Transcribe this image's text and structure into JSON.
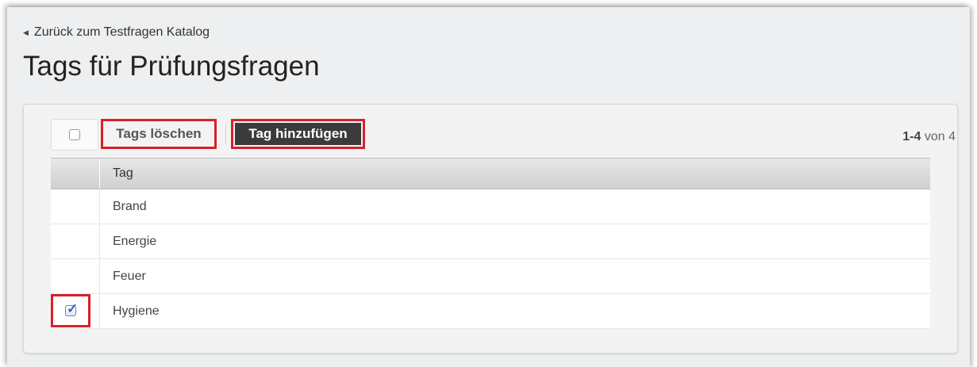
{
  "nav": {
    "back_label": "Zurück zum Testfragen Katalog"
  },
  "page": {
    "title": "Tags für Prüfungsfragen"
  },
  "toolbar": {
    "delete_label": "Tags löschen",
    "add_label": "Tag hinzufügen",
    "range": "1-4",
    "of_label": "von 4"
  },
  "table": {
    "header": "Tag",
    "rows": [
      {
        "label": "Brand",
        "checked": false
      },
      {
        "label": "Energie",
        "checked": false
      },
      {
        "label": "Feuer",
        "checked": false
      },
      {
        "label": "Hygiene",
        "checked": true
      }
    ]
  },
  "colors": {
    "highlight": "#d8202a",
    "primary_button": "#3b3b3b",
    "check": "#2f66c4"
  },
  "icons": {
    "back": "left-triangle-icon",
    "check": "checkmark-icon"
  }
}
